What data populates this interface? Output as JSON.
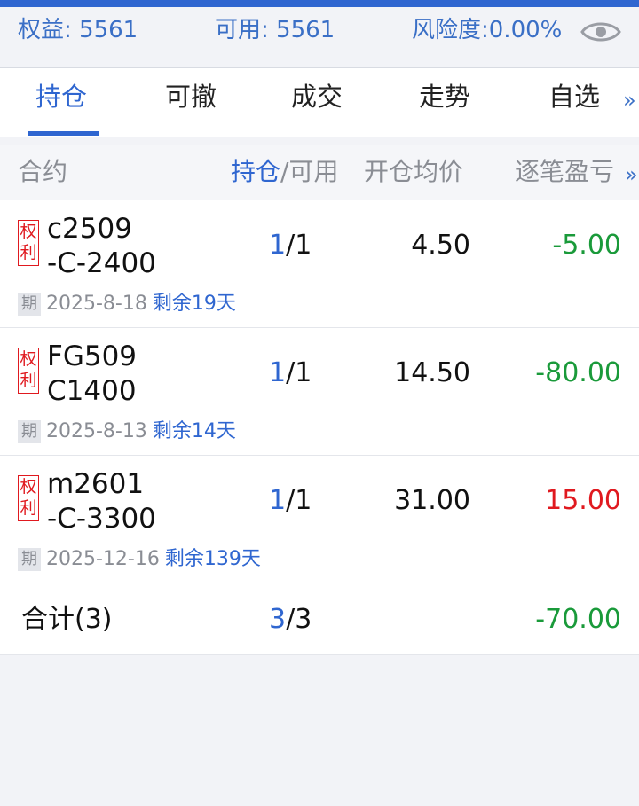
{
  "colors": {
    "accent": "#2f66d0",
    "profit": "#e0191f",
    "loss": "#1a9a3a",
    "muted": "#8a8d94"
  },
  "summary": {
    "equity": "权益: 5561",
    "available": "可用: 5561",
    "risk": "风险度:0.00%",
    "eye_icon": "eye-icon"
  },
  "tabs": {
    "items": [
      "持仓",
      "可撤",
      "成交",
      "走势",
      "自选"
    ],
    "active": "持仓",
    "more": "»"
  },
  "table_header": {
    "contract": "合约",
    "position": "持仓",
    "available": "/可用",
    "avg_price": "开仓均价",
    "pnl": "逐笔盈亏",
    "more": "»"
  },
  "positions": [
    {
      "badge_top": "权",
      "badge_bottom": "利",
      "name_line1": "c2509",
      "name_line2": "-C-2400",
      "qty_held": "1",
      "qty_sep_avail": "/1",
      "avg_price": "4.50",
      "pnl": "-5.00",
      "expiry_label": "期",
      "expiry_date": "2025-8-18",
      "remaining": "剩余19天"
    },
    {
      "badge_top": "权",
      "badge_bottom": "利",
      "name_line1": "FG509",
      "name_line2": "C1400",
      "qty_held": "1",
      "qty_sep_avail": "/1",
      "avg_price": "14.50",
      "pnl": "-80.00",
      "expiry_label": "期",
      "expiry_date": "2025-8-13",
      "remaining": "剩余14天"
    },
    {
      "badge_top": "权",
      "badge_bottom": "利",
      "name_line1": "m2601",
      "name_line2": "-C-3300",
      "qty_held": "1",
      "qty_sep_avail": "/1",
      "avg_price": "31.00",
      "pnl": "15.00",
      "expiry_label": "期",
      "expiry_date": "2025-12-16",
      "remaining": "剩余139天"
    }
  ],
  "total": {
    "label": "合计(3)",
    "qty_held": "3",
    "qty_sep_avail": "/3",
    "pnl": "-70.00"
  }
}
